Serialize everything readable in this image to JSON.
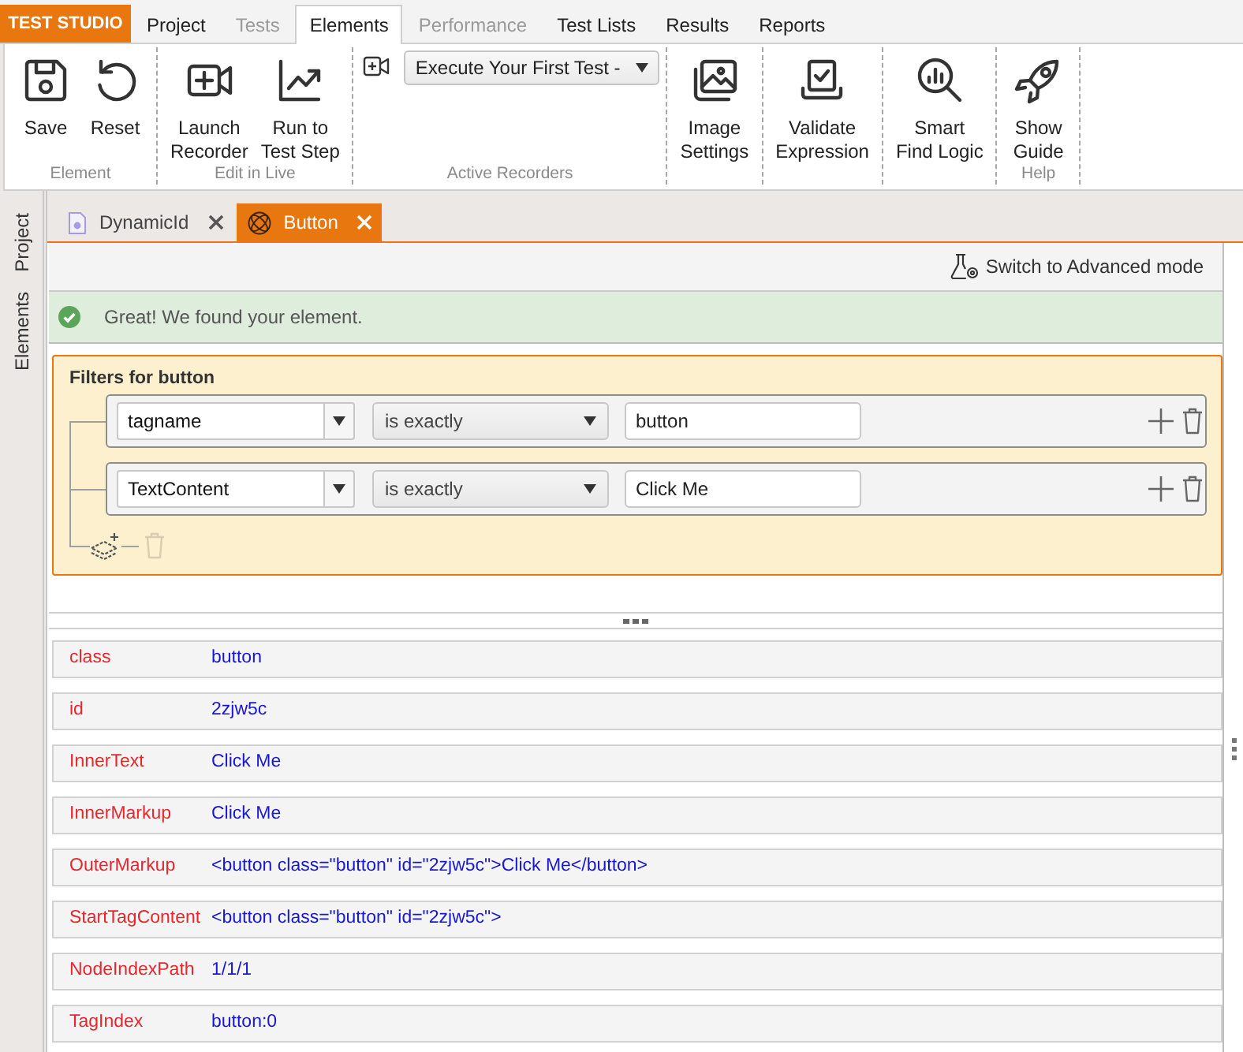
{
  "brand": {
    "label": "TEST STUDIO"
  },
  "menu_tabs": [
    {
      "label": "Project",
      "selected": false,
      "disabled": false
    },
    {
      "label": "Tests",
      "selected": false,
      "disabled": true
    },
    {
      "label": "Elements",
      "selected": true,
      "disabled": false
    },
    {
      "label": "Performance",
      "selected": false,
      "disabled": true
    },
    {
      "label": "Test Lists",
      "selected": false,
      "disabled": false
    },
    {
      "label": "Results",
      "selected": false,
      "disabled": false
    },
    {
      "label": "Reports",
      "selected": false,
      "disabled": false
    }
  ],
  "ribbon": {
    "groups": [
      {
        "label": "Element",
        "items": [
          {
            "kind": "large",
            "lines": [
              "Save"
            ]
          },
          {
            "kind": "large",
            "lines": [
              "Reset"
            ]
          }
        ]
      },
      {
        "label": "Edit in Live",
        "items": [
          {
            "kind": "large",
            "lines": [
              "Launch",
              "Recorder"
            ]
          },
          {
            "kind": "large",
            "lines": [
              "Run to",
              "Test Step"
            ]
          }
        ]
      },
      {
        "label": "Active Recorders",
        "items": [
          {
            "kind": "dropdown",
            "value": "Execute Your First Test -"
          }
        ]
      },
      {
        "items": [
          {
            "kind": "large",
            "lines": [
              "Image",
              "Settings"
            ]
          }
        ]
      },
      {
        "items": [
          {
            "kind": "large",
            "lines": [
              "Validate",
              "Expression"
            ]
          }
        ]
      },
      {
        "items": [
          {
            "kind": "large",
            "lines": [
              "Smart",
              "Find Logic"
            ]
          }
        ]
      },
      {
        "label": "Help",
        "items": [
          {
            "kind": "large",
            "lines": [
              "Show",
              "Guide"
            ]
          }
        ]
      }
    ]
  },
  "side_tabs": [
    {
      "label": "Project"
    },
    {
      "label": "Elements"
    }
  ],
  "document_tabs": [
    {
      "label": "DynamicId",
      "selected": false
    },
    {
      "label": "Button",
      "selected": true
    }
  ],
  "toolbar": {
    "mode_link": "Switch to Advanced mode"
  },
  "status_message": {
    "text": "Great! We found your element."
  },
  "filters": {
    "title": "Filters for button",
    "rows": [
      {
        "attribute": "tagname",
        "operator": "is exactly",
        "value": "button"
      },
      {
        "attribute": "TextContent",
        "operator": "is exactly",
        "value": "Click Me"
      }
    ],
    "delete_group_disabled": true
  },
  "properties": [
    {
      "name": "class",
      "value": "button"
    },
    {
      "name": "id",
      "value": "2zjw5c"
    },
    {
      "name": "InnerText",
      "value": "Click Me"
    },
    {
      "name": "InnerMarkup",
      "value": "Click Me"
    },
    {
      "name": "OuterMarkup",
      "value": "<button class=\"button\" id=\"2zjw5c\">Click Me</button>"
    },
    {
      "name": "StartTagContent",
      "value": "<button class=\"button\" id=\"2zjw5c\">"
    },
    {
      "name": "NodeIndexPath",
      "value": "1/1/1"
    },
    {
      "name": "TagIndex",
      "value": "button:0"
    }
  ]
}
